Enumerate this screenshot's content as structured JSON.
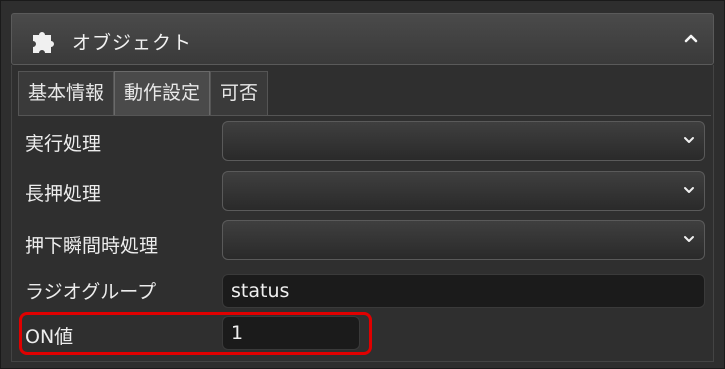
{
  "panel": {
    "title": "オブジェクト",
    "icons": {
      "title_icon": "puzzle-icon",
      "collapse_icon": "chevron-up-icon"
    }
  },
  "tabs": [
    {
      "label": "基本情報",
      "active": false
    },
    {
      "label": "動作設定",
      "active": true
    },
    {
      "label": "可否",
      "active": false
    }
  ],
  "fields": {
    "execute": {
      "label": "実行処理",
      "value": ""
    },
    "long_press": {
      "label": "長押処理",
      "value": ""
    },
    "press_moment": {
      "label": "押下瞬間時処理",
      "value": ""
    },
    "radio_group": {
      "label": "ラジオグループ",
      "value": "status"
    },
    "on_value": {
      "label": "ON値",
      "value": "1"
    }
  },
  "highlight_color": "#e00000"
}
